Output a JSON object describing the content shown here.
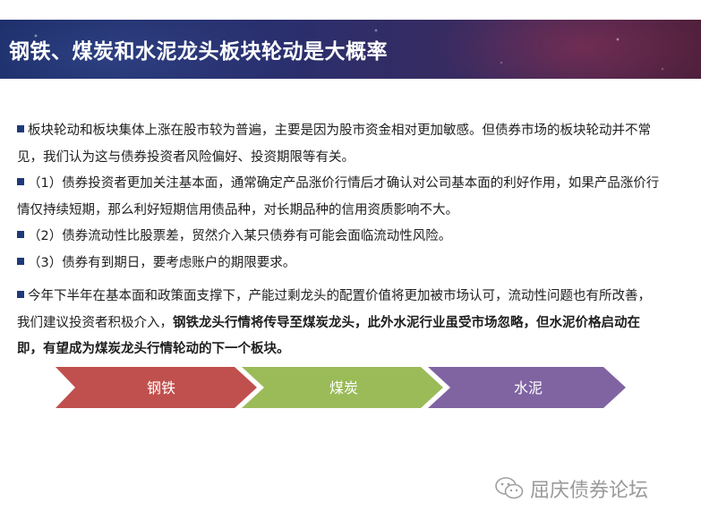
{
  "header": {
    "title": "钢铁、煤炭和水泥龙头板块轮动是大概率"
  },
  "content": {
    "p1": "板块轮动和板块集体上涨在股市较为普遍，主要是因为股市资金相对更加敏感。但债券市场的板块轮动并不常见，我们认为这与债券投资者风险偏好、投资期限等有关。",
    "p2": "（1）债券投资者更加关注基本面，通常确定产品涨价行情后才确认对公司基本面的利好作用，如果产品涨价行情仅持续短期，那么利好短期信用债品种，对长期品种的信用资质影响不大。",
    "p3": "（2）债券流动性比股票差，贸然介入某只债券有可能会面临流动性风险。",
    "p4": "（3）债券有到期日，要考虑账户的期限要求。",
    "p5_normal": "今年下半年在基本面和政策面支撑下，产能过剩龙头的配置价值将更加被市场认可，流动性问题也有所改善，我们建议投资者积极介入，",
    "p5_bold": "钢铁龙头行情将传导至煤炭龙头，此外水泥行业虽受市场忽略，但水泥价格启动在即，有望成为煤炭龙头行情轮动的下一个板块。"
  },
  "flow": {
    "steps": [
      {
        "label": "钢铁",
        "color": "#c0504d"
      },
      {
        "label": "煤炭",
        "color": "#9bbb59"
      },
      {
        "label": "水泥",
        "color": "#8064a2"
      }
    ]
  },
  "footer": {
    "brand": "屈庆债券论坛",
    "icon": "wechat-icon"
  },
  "colors": {
    "bullet": "#1f3a7a",
    "title": "#ffffff",
    "footer_text": "#9a9a9a"
  }
}
